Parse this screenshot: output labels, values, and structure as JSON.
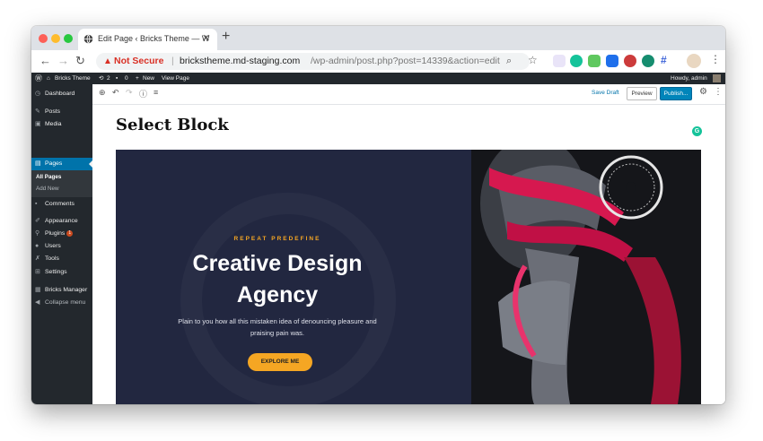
{
  "browser": {
    "tab_title": "Edit Page ‹ Bricks Theme — W",
    "url_security": "Not Secure",
    "url_host": "brickstheme.md-staging.com",
    "url_path": "/wp-admin/post.php?post=14339&action=edit"
  },
  "adminbar": {
    "site_name": "Bricks Theme",
    "updates_count": "2",
    "comments_count": "0",
    "new_label": "New",
    "view_label": "View Page",
    "greeting": "Howdy, admin"
  },
  "sidebar": {
    "items": [
      {
        "label": "Dashboard"
      },
      {
        "label": "Posts"
      },
      {
        "label": "Media"
      },
      {
        "label": "Pages"
      },
      {
        "label": "Comments"
      },
      {
        "label": "Appearance"
      },
      {
        "label": "Plugins",
        "badge": "1"
      },
      {
        "label": "Users"
      },
      {
        "label": "Tools"
      },
      {
        "label": "Settings"
      },
      {
        "label": "Bricks Manager"
      },
      {
        "label": "Collapse menu"
      }
    ],
    "sub_items": [
      {
        "label": "All Pages"
      },
      {
        "label": "Add New"
      }
    ]
  },
  "editor": {
    "save_draft": "Save Draft",
    "preview": "Preview",
    "publish": "Publish...",
    "page_title": "Select Block"
  },
  "hero": {
    "eyebrow": "REPEAT PREDEFINE",
    "heading": "Creative Design Agency",
    "description": "Plain to you how all this mistaken idea of denouncing pleasure and praising pain was.",
    "cta": "EXPLORE ME"
  },
  "colors": {
    "accent": "#f5a623",
    "hero_bg": "#222740",
    "wp_blue": "#0073aa"
  }
}
